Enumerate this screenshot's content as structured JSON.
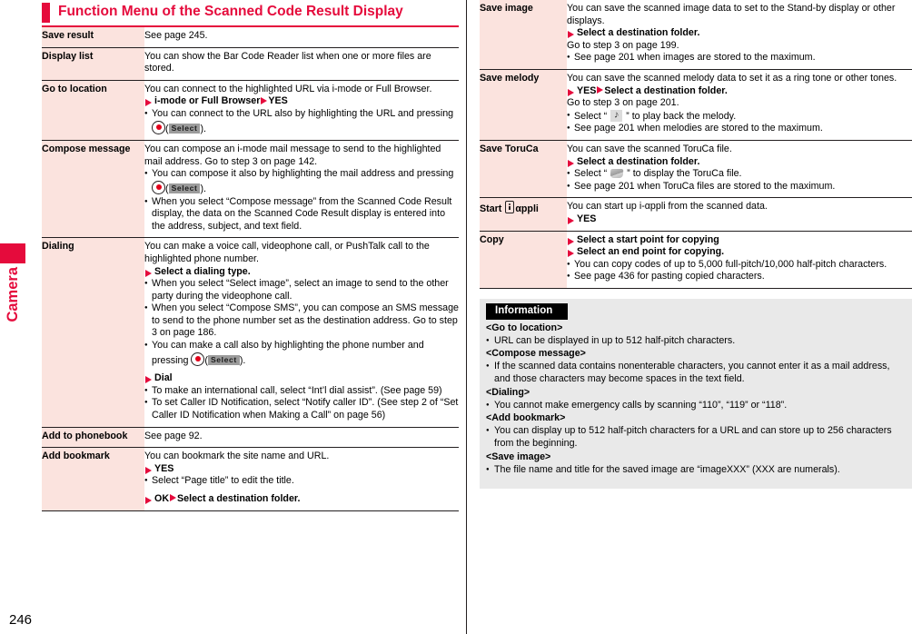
{
  "page": {
    "number": "246",
    "side_tab_label": "Camera",
    "accent_color": "#e50b3c",
    "term_bg_color": "#fbe3de",
    "info_bg_color": "#e9e9e9"
  },
  "heading": {
    "title": "Function Menu of the Scanned Code Result Display"
  },
  "left_table": {
    "rows": [
      {
        "term": "Save result",
        "lines": [
          {
            "type": "text",
            "text": "See page 245."
          }
        ]
      },
      {
        "term": "Display list",
        "lines": [
          {
            "type": "text",
            "text": "You can show the Bar Code Reader list when one or more files are stored."
          }
        ]
      },
      {
        "term": "Go to location",
        "lines": [
          {
            "type": "text",
            "text": "You can connect to the highlighted URL via i-mode or Full Browser."
          },
          {
            "type": "arrow2",
            "text1": "i-mode or Full Browser",
            "text2": "YES"
          },
          {
            "type": "bullet-key",
            "pre": "You can connect to the URL also by highlighting the URL and pressing ",
            "key": "select-key",
            "softkey": "Select",
            "post": "."
          }
        ]
      },
      {
        "term": "Compose message",
        "lines": [
          {
            "type": "text",
            "text": "You can compose an i-mode mail message to send to the highlighted mail address. Go to step 3 on page 142."
          },
          {
            "type": "bullet-key",
            "pre": "You can compose it also by highlighting the mail address and pressing ",
            "key": "select-key",
            "softkey": "Select",
            "post": "."
          },
          {
            "type": "bullet",
            "text": "When you select “Compose message” from the Scanned Code Result display, the data on the Scanned Code Result display is entered into the address, subject, and text field."
          }
        ]
      },
      {
        "term": "Dialing",
        "lines": [
          {
            "type": "text",
            "text": "You can make a voice call, videophone call, or PushTalk call to the highlighted phone number."
          },
          {
            "type": "arrow",
            "text": "Select a dialing type."
          },
          {
            "type": "bullet",
            "text": "When you select “Select image”, select an image to send to the other party during the videophone call."
          },
          {
            "type": "bullet",
            "text": "When you select “Compose SMS”, you can compose an SMS message to send to the phone number set as the destination address. Go to step 3 on page 186."
          },
          {
            "type": "bullet-key",
            "pre": "You can make a call also by highlighting the phone number and pressing ",
            "key": "select-key",
            "softkey": "Select",
            "post": "."
          },
          {
            "type": "arrow-spaced",
            "text": "Dial"
          },
          {
            "type": "bullet",
            "text": "To make an international call, select “Int’l dial assist”. (See page 59)"
          },
          {
            "type": "bullet",
            "text": "To set Caller ID Notification, select “Notify caller ID”. (See step 2 of “Set Caller ID Notification when Making a Call” on page 56)"
          }
        ]
      },
      {
        "term": "Add to phonebook",
        "lines": [
          {
            "type": "text",
            "text": "See page 92."
          }
        ]
      },
      {
        "term": "Add bookmark",
        "lines": [
          {
            "type": "text",
            "text": "You can bookmark the site name and URL."
          },
          {
            "type": "arrow",
            "text": "YES"
          },
          {
            "type": "bullet",
            "text": "Select “Page title” to edit the title."
          },
          {
            "type": "arrow2-spaced",
            "text1": "OK",
            "text2": "Select a destination folder."
          }
        ]
      }
    ]
  },
  "right_table": {
    "rows": [
      {
        "term": "Save image",
        "lines": [
          {
            "type": "text",
            "text": "You can save the scanned image data to set to the Stand-by display or other displays."
          },
          {
            "type": "arrow",
            "text": "Select a destination folder."
          },
          {
            "type": "text",
            "text": "Go to step 3 on page 199."
          },
          {
            "type": "bullet",
            "text": "See page 201 when images are stored to the maximum."
          }
        ]
      },
      {
        "term": "Save melody",
        "lines": [
          {
            "type": "text",
            "text": "You can save the scanned melody data to set it as a ring tone or other tones."
          },
          {
            "type": "arrow2",
            "text1": "YES",
            "text2": "Select a destination folder."
          },
          {
            "type": "text",
            "text": "Go to step 3 on page 201."
          },
          {
            "type": "bullet-icon",
            "pre": "Select “",
            "icon": "melody-note-icon",
            "post": "” to play back the melody."
          },
          {
            "type": "bullet",
            "text": "See page 201 when melodies are stored to the maximum."
          }
        ]
      },
      {
        "term": "Save ToruCa",
        "lines": [
          {
            "type": "text",
            "text": "You can save the scanned ToruCa file."
          },
          {
            "type": "arrow",
            "text": "Select a destination folder."
          },
          {
            "type": "bullet-icon",
            "pre": "Select “",
            "icon": "toruca-icon",
            "post": "” to display the ToruCa file."
          },
          {
            "type": "bullet",
            "text": "See page 201 when ToruCa files are stored to the maximum."
          }
        ]
      },
      {
        "term_parts": {
          "pre": "Start ",
          "icon": "i-appli-logo-icon",
          "post": "αppli"
        },
        "term": "Start i-αppli",
        "lines": [
          {
            "type": "text",
            "text": "You can start up i-αppli from the scanned data."
          },
          {
            "type": "arrow",
            "text": "YES"
          }
        ]
      },
      {
        "term": "Copy",
        "lines": [
          {
            "type": "arrow",
            "text": "Select a start point for copying"
          },
          {
            "type": "arrow",
            "text": "Select an end point for copying."
          },
          {
            "type": "bullet",
            "text": "You can copy codes of up to 5,000 full-pitch/10,000 half-pitch characters."
          },
          {
            "type": "bullet",
            "text": "See page 436 for pasting copied characters."
          }
        ]
      }
    ]
  },
  "information": {
    "header": "Information",
    "sections": [
      {
        "title": "<Go to location>",
        "bullets": [
          "URL can be displayed in up to 512 half-pitch characters."
        ]
      },
      {
        "title": "<Compose message>",
        "bullets": [
          "If the scanned data contains nonenterable characters, you cannot enter it as a mail address, and those characters may become spaces in the text field."
        ]
      },
      {
        "title": "<Dialing>",
        "bullets": [
          "You cannot make emergency calls by scanning “110”, “119” or “118”."
        ]
      },
      {
        "title": "<Add bookmark>",
        "bullets": [
          "You can display up to 512 half-pitch characters for a URL and can store up to 256 characters from the beginning."
        ]
      },
      {
        "title": "<Save image>",
        "bullets": [
          "The file name and title for the saved image are “imageXXX” (XXX are numerals)."
        ]
      }
    ]
  }
}
